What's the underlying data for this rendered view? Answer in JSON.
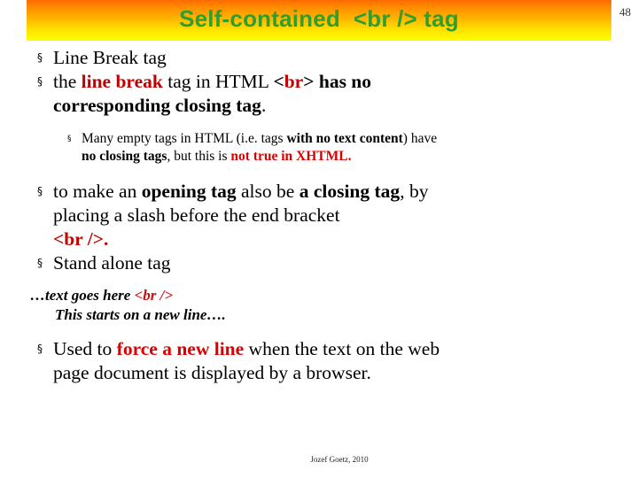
{
  "slide": {
    "page_number": "48",
    "title": "Self-contained  <br /> tag",
    "title_color": "#2f9e2f",
    "band_gradient_from": "#ff6a00",
    "band_gradient_to": "#ffff00",
    "accent_red": "#c00000",
    "bullet_glyph": "§",
    "sub_bullet_glyph": "§"
  },
  "bullets": {
    "b1": {
      "text": "Line Break tag"
    },
    "b2": {
      "t1": "the ",
      "t2_bold_red": "line break",
      "t3": " tag in HTML ",
      "t4_bracket_open": "<",
      "t5_bold_red": "br",
      "t6_bracket_close": ">",
      "t7_bold": " has no",
      "line2_bold": "corresponding closing tag",
      "line2_tail": "."
    },
    "sub1": {
      "t1": "Many empty tags in HTML (i.e. tags ",
      "t2_bold": "with no text content",
      "t3": ") have",
      "l2_t1_bold": "no closing tags",
      "l2_t2": ", but this is ",
      "l2_t3_bold_red": "not true in XHTML."
    },
    "b3": {
      "t1": "to make an ",
      "t2_bold": "opening tag",
      "t3": " also be ",
      "t4_bold": "a closing tag",
      "t5": ", by",
      "line2": "placing a slash before the end bracket",
      "line3_red_bold": "<br />."
    },
    "b4": {
      "text": "Stand alone tag"
    },
    "italic_block": {
      "line1_a": "…text goes here ",
      "line1_b_red": "<br />",
      "line2": "This starts on a new line…."
    },
    "b5": {
      "t1": "Used to ",
      "t2_bold_red": "force a new line",
      "t3": " when the text on the web",
      "line2": "page document is displayed by a browser."
    }
  },
  "footer": {
    "credit": "Jozef Goetz, 2010"
  }
}
